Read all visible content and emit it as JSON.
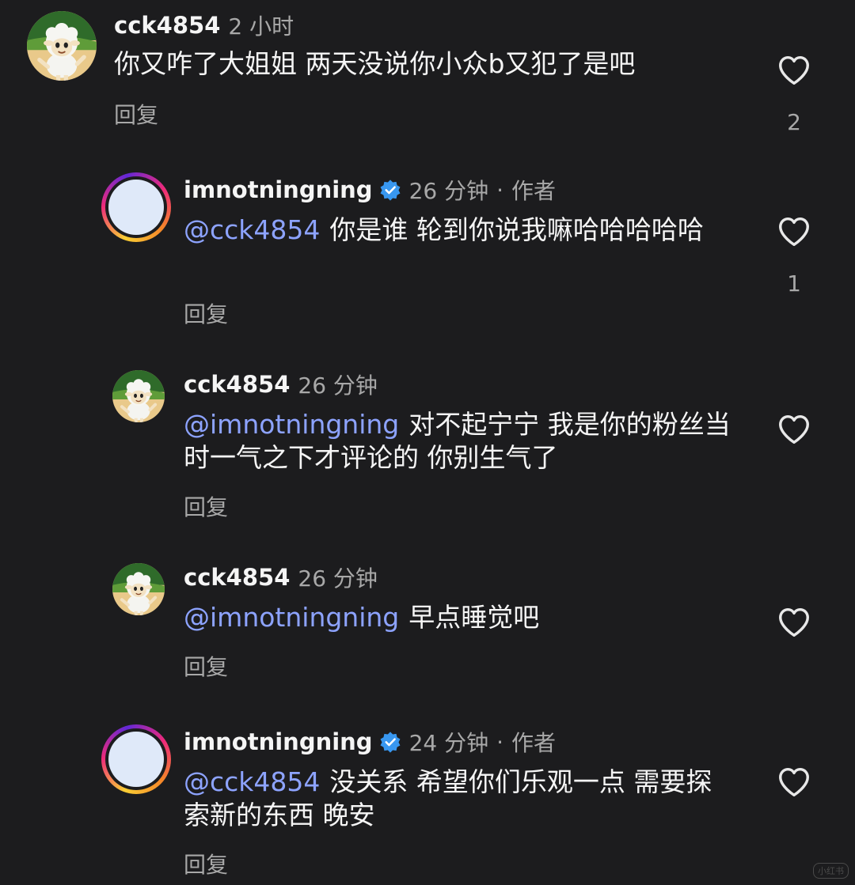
{
  "colors": {
    "background": "#1c1c1e",
    "mention": "#8da3ff",
    "secondary_text": "#a8a8a8",
    "verified": "#3897f0"
  },
  "comments": [
    {
      "username": "cck4854",
      "time": "2 小时",
      "text": "你又咋了大姐姐 两天没说你小众b又犯了是吧",
      "reply_label": "回复",
      "like_count": "2",
      "avatar": "sheep-avatar-icon"
    },
    {
      "username": "imnotningning",
      "verified": true,
      "time": "26 分钟",
      "author_label": "作者",
      "mention": "@cck4854",
      "text": "你是谁 轮到你说我嘛哈哈哈哈哈",
      "reply_label": "回复",
      "like_count": "1"
    },
    {
      "username": "cck4854",
      "time": "26 分钟",
      "mention": "@imnotningning",
      "text": "对不起宁宁 我是你的粉丝当时一气之下才评论的 你别生气了",
      "reply_label": "回复",
      "avatar": "sheep-avatar-icon"
    },
    {
      "username": "cck4854",
      "time": "26 分钟",
      "mention": "@imnotningning",
      "text": "早点睡觉吧",
      "reply_label": "回复",
      "avatar": "sheep-avatar-icon"
    },
    {
      "username": "imnotningning",
      "verified": true,
      "time": "24 分钟",
      "author_label": "作者",
      "mention": "@cck4854",
      "text": "没关系 希望你们乐观一点 需要探索新的东西 晚安",
      "reply_label": "回复"
    }
  ],
  "separator": "·",
  "watermark": "小红书"
}
